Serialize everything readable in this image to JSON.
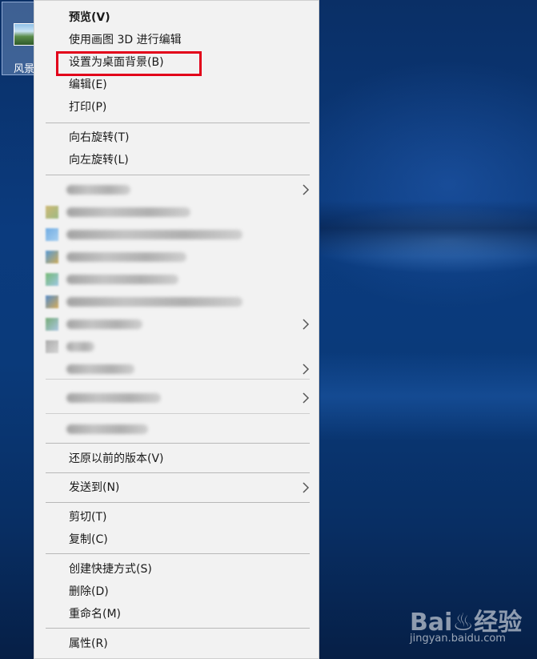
{
  "desktop": {
    "icon_label": "风景"
  },
  "context_menu": {
    "items": [
      {
        "label": "预览(V)"
      },
      {
        "label": "使用画图 3D 进行编辑"
      },
      {
        "label": "设置为桌面背景(B)"
      },
      {
        "label": "编辑(E)"
      },
      {
        "label": "打印(P)"
      },
      {
        "label": "向右旋转(T)"
      },
      {
        "label": "向左旋转(L)"
      },
      {
        "label": "还原以前的版本(V)"
      },
      {
        "label": "发送到(N)"
      },
      {
        "label": "剪切(T)"
      },
      {
        "label": "复制(C)"
      },
      {
        "label": "创建快捷方式(S)"
      },
      {
        "label": "删除(D)"
      },
      {
        "label": "重命名(M)"
      },
      {
        "label": "属性(R)"
      }
    ],
    "highlight_color": "#e2001a",
    "background_color": "#f2f2f2"
  },
  "watermark": {
    "logo": "Bai♨经验",
    "url": "jingyan.baidu.com"
  }
}
